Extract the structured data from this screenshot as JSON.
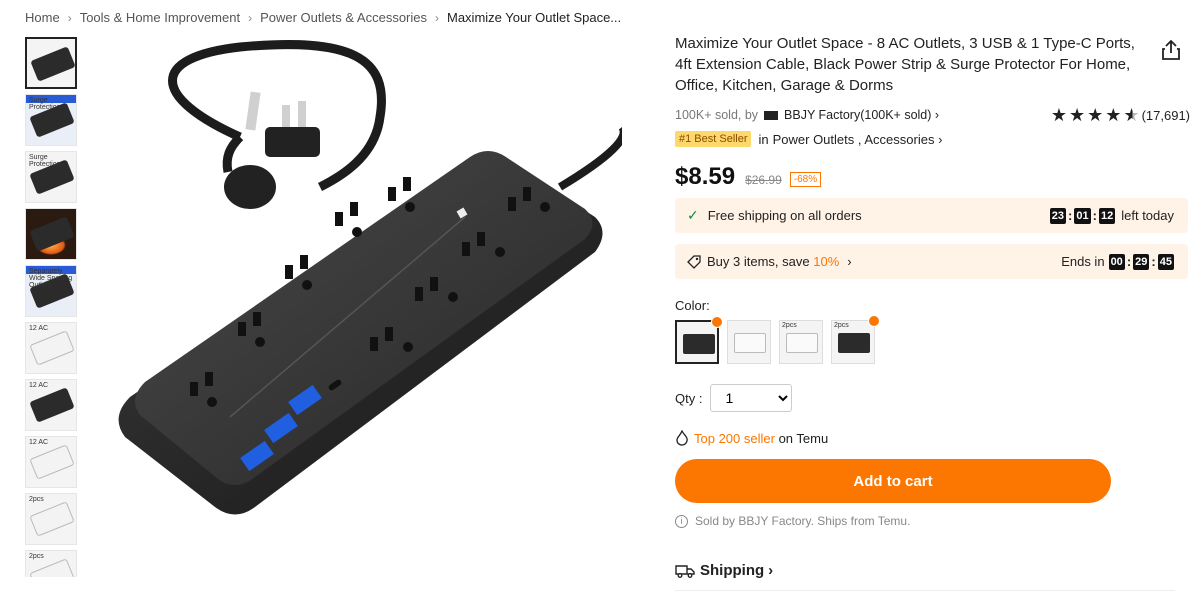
{
  "breadcrumb": [
    "Home",
    "Tools & Home Improvement",
    "Power Outlets & Accessories",
    "Maximize Your Outlet Space..."
  ],
  "thumbnails": [
    {
      "kind": "black",
      "label": "",
      "active": true
    },
    {
      "kind": "blue",
      "label": "Surge Protection"
    },
    {
      "kind": "black",
      "label": "Surge Protection"
    },
    {
      "kind": "fire",
      "label": ""
    },
    {
      "kind": "blue",
      "label": "Separately Wide Spacing Outlets"
    },
    {
      "kind": "white",
      "label": "12 AC"
    },
    {
      "kind": "black",
      "label": "12 AC"
    },
    {
      "kind": "white",
      "label": "12 AC"
    },
    {
      "kind": "white",
      "label": "2pcs"
    },
    {
      "kind": "white",
      "label": "2pcs"
    }
  ],
  "product": {
    "title": "Maximize Your Outlet Space - 8 AC Outlets, 3 USB & 1 Type-C Ports, 4ft Extension Cable, Black Power Strip & Surge Protector For Home, Office, Kitchen, Garage & Dorms",
    "sold": "100K+ sold, by",
    "store": "BBJY Factory(100K+ sold)",
    "rating_count": "(17,691)",
    "rating": 4.5,
    "badge": "#1 Best Seller",
    "category_prefix": "in",
    "category": "Power Outlets , Accessories",
    "price": "$8.59",
    "old_price": "$26.99",
    "discount": "-68%"
  },
  "shipping_banner": {
    "text": "Free shipping on all orders",
    "timer": [
      "23",
      "01",
      "12"
    ],
    "suffix": "left today"
  },
  "promo_banner": {
    "text": "Buy 3 items, save",
    "percent": "10%",
    "prefix": "Ends in",
    "timer": [
      "00",
      "29",
      "45"
    ]
  },
  "color": {
    "label": "Color:",
    "swatches": [
      {
        "kind": "black",
        "label": "",
        "selected": true,
        "hot": true
      },
      {
        "kind": "white",
        "label": "",
        "selected": false,
        "hot": false
      },
      {
        "kind": "white",
        "label": "2pcs",
        "selected": false,
        "hot": false
      },
      {
        "kind": "black",
        "label": "2pcs",
        "selected": false,
        "hot": true
      }
    ]
  },
  "qty": {
    "label": "Qty :",
    "value": "1"
  },
  "top_seller": {
    "highlight": "Top 200 seller",
    "suffix": "on Temu"
  },
  "add_to_cart": "Add to cart",
  "sold_by": "Sold by BBJY Factory. Ships from Temu.",
  "shipping_heading": "Shipping",
  "colors": {
    "accent": "#fb7701",
    "banner_bg": "#fff2e6",
    "check": "#0a8a3a"
  }
}
